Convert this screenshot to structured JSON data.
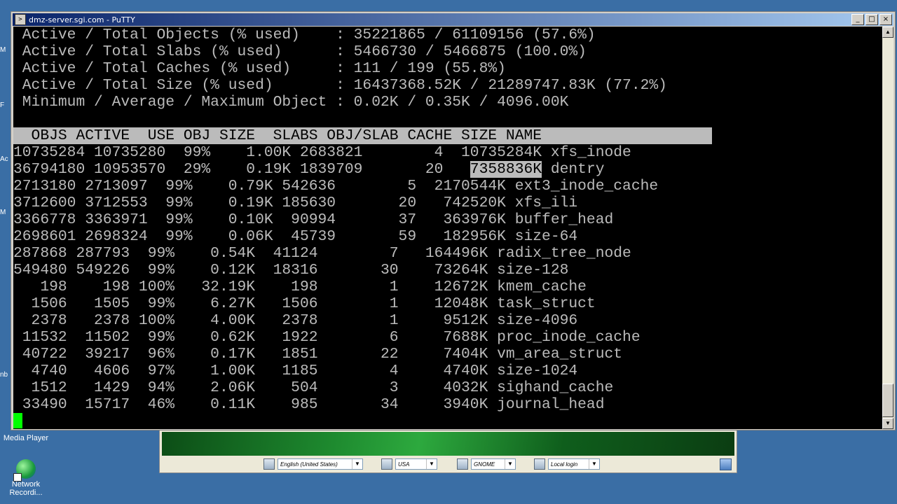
{
  "window": {
    "title": "dmz-server.sgi.com - PuTTY",
    "minimize": "_",
    "maximize": "□",
    "close": "×"
  },
  "terminal": {
    "summary_lines": [
      " Active / Total Objects (% used)    : 35221865 / 61109156 (57.6%)",
      " Active / Total Slabs (% used)      : 5466730 / 5466875 (100.0%)",
      " Active / Total Caches (% used)     : 111 / 199 (55.8%)",
      " Active / Total Size (% used)       : 16437368.52K / 21289747.83K (77.2%)",
      " Minimum / Average / Maximum Object : 0.02K / 0.35K / 4096.00K"
    ],
    "header": "  OBJS ACTIVE  USE OBJ SIZE  SLABS OBJ/SLAB CACHE SIZE NAME",
    "rows": [
      "10735284 10735280  99%    1.00K 2683821        4  10735284K xfs_inode",
      "36794180 10953570  29%    0.19K 1839709       20   7358836K dentry",
      "2713180 2713097  99%    0.79K 542636        5  2170544K ext3_inode_cache",
      "3712600 3712553  99%    0.19K 185630       20   742520K xfs_ili",
      "3366778 3363971  99%    0.10K  90994       37   363976K buffer_head",
      "2698601 2698324  99%    0.06K  45739       59   182956K size-64",
      "287868 287793  99%    0.54K  41124        7   164496K radix_tree_node",
      "549480 549226  99%    0.12K  18316       30    73264K size-128",
      "   198    198 100%   32.19K    198        1    12672K kmem_cache",
      "  1506   1505  99%    6.27K   1506        1    12048K task_struct",
      "  2378   2378 100%    4.00K   2378        1     9512K size-4096",
      " 11532  11502  99%    0.62K   1922        6     7688K proc_inode_cache",
      " 40722  39217  96%    0.17K   1851       22     7404K vm_area_struct",
      "  4740   4606  97%    1.00K   1185        4     4740K size-1024",
      "  1512   1429  94%    2.06K    504        3     4032K sighand_cache",
      " 33490  15717  46%    0.11K    985       34     3940K journal_head"
    ],
    "dentry_prefix": "36794180 10953570  29%    0.19K 1839709       20   ",
    "dentry_selected": "7358836K",
    "dentry_suffix": " dentry"
  },
  "desktop": {
    "media_player_label": "Media Player",
    "network_label_1": "Network",
    "network_label_2": "Recordi...",
    "icon_name": "network-recorder-icon"
  },
  "login_bar": {
    "language": "English (United States)",
    "keyboard": "USA",
    "session": "GNOME",
    "login_type": "Local login"
  }
}
